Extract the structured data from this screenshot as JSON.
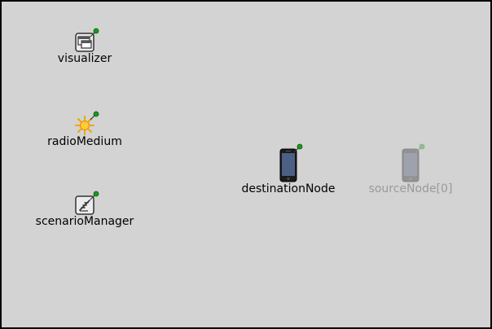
{
  "canvas": {
    "background": "#d3d3d3",
    "border": "#000000"
  },
  "modules": {
    "visualizer": {
      "label": "visualizer",
      "icon": "visualizer-window-icon"
    },
    "radioMedium": {
      "label": "radioMedium",
      "icon": "radio-medium-sun-icon"
    },
    "scenarioManager": {
      "label": "scenarioManager",
      "icon": "scenario-manager-icon"
    },
    "destinationNode": {
      "label": "destinationNode",
      "icon": "mobile-phone-icon"
    },
    "sourceNode": {
      "label": "sourceNode[0]",
      "icon": "mobile-phone-icon",
      "state": "disabled"
    }
  },
  "colors": {
    "label": "#000000",
    "disabled_label": "#9a9a9a",
    "pin": "#1a9a1a"
  }
}
